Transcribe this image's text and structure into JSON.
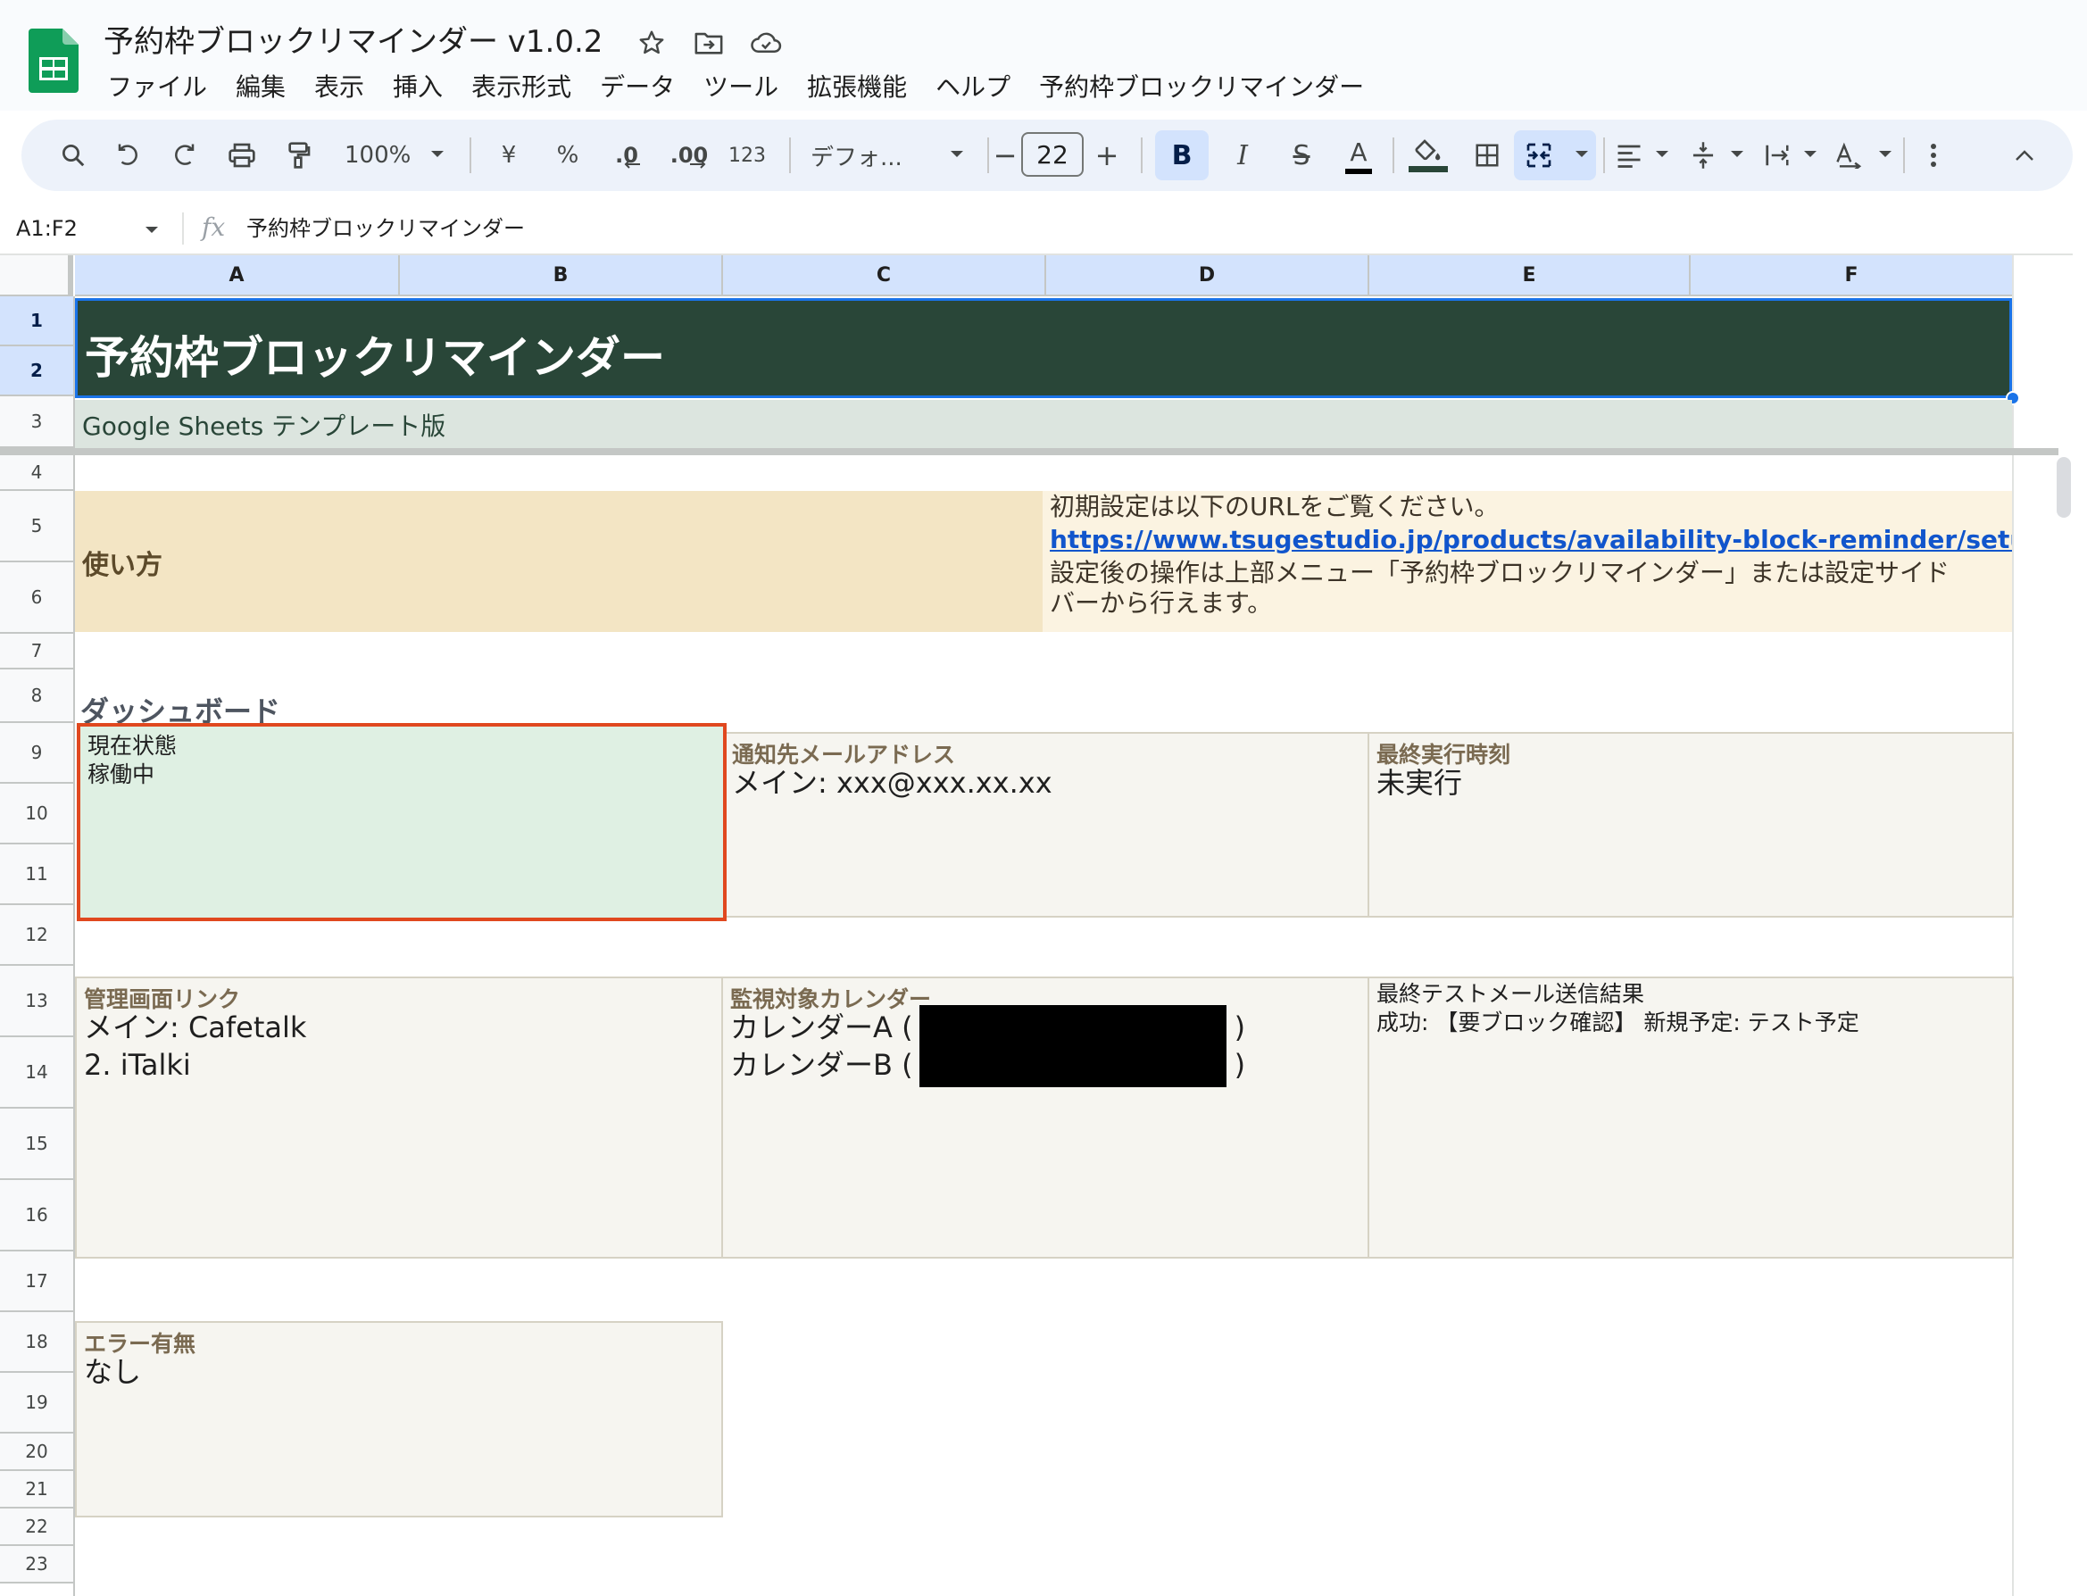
{
  "app": {
    "doc_title": "予約枠ブロックリマインダー v1.0.2",
    "menu": [
      "ファイル",
      "編集",
      "表示",
      "挿入",
      "表示形式",
      "データ",
      "ツール",
      "拡張機能",
      "ヘルプ",
      "予約枠ブロックリマインダー"
    ]
  },
  "toolbar": {
    "zoom": "100%",
    "currency": "¥",
    "percent": "%",
    "decrease_decimal": ".0",
    "increase_decimal": ".00",
    "number_format": "123",
    "font": "デフォ...",
    "font_size": "22",
    "minus": "−",
    "plus": "+",
    "bold": "B",
    "italic": "I",
    "strike": "S",
    "text_color": "A",
    "text_color_value": "#000000",
    "fill_color_value": "#294638"
  },
  "formula_bar": {
    "name_box": "A1:F2",
    "fx": "fx",
    "content": "予約枠ブロックリマインダー"
  },
  "grid": {
    "columns": [
      "A",
      "B",
      "C",
      "D",
      "E",
      "F"
    ],
    "rows": [
      "1",
      "2",
      "3",
      "4",
      "5",
      "6",
      "7",
      "8",
      "9",
      "10",
      "11",
      "12",
      "13",
      "14",
      "15",
      "16",
      "17",
      "18",
      "19",
      "20",
      "21",
      "22",
      "23"
    ]
  },
  "sheet": {
    "title": "予約枠ブロックリマインダー",
    "subtitle": "Google Sheets テンプレート版",
    "howto_title": "使い方",
    "howto_note_line1": "初期設定は以下のURLをご覧ください。",
    "howto_link": "https://www.tsugestudio.jp/products/availability-block-reminder/setup/",
    "howto_note_line2": "設定後の操作は上部メニュー「予約枠ブロックリマインダー」または設定サイド",
    "howto_note_line3": "バーから行えます。",
    "dashboard_heading": "ダッシュボード",
    "status_label": "現在状態",
    "status_value": "稼働中",
    "email_label": "通知先メールアドレス",
    "email_value": "メイン: xxx@xxx.xx.xx",
    "last_run_label": "最終実行時刻",
    "last_run_value": "未実行",
    "admin_label": "管理画面リンク",
    "admin_line1": "メイン: Cafetalk",
    "admin_line2": "2. iTalki",
    "calendar_label": "監視対象カレンダー",
    "calendar_line1": "カレンダーA (",
    "calendar_line2": "カレンダーB (",
    "paren_close": ")",
    "test_label": "最終テストメール送信結果",
    "test_value": "成功: 【要ブロック確認】 新規予定: テスト予定",
    "error_label": "エラー有無",
    "error_value": "なし"
  },
  "colors": {
    "title_fill": "#294638",
    "subtitle_fill": "#dce5df",
    "howto_fill": "#f3e5c4",
    "status_fill": "#dff0e3",
    "card_fill": "#f6f5f0",
    "selection_border": "#1a73e8",
    "highlight_border": "#e0481f",
    "link": "#1155cc"
  }
}
